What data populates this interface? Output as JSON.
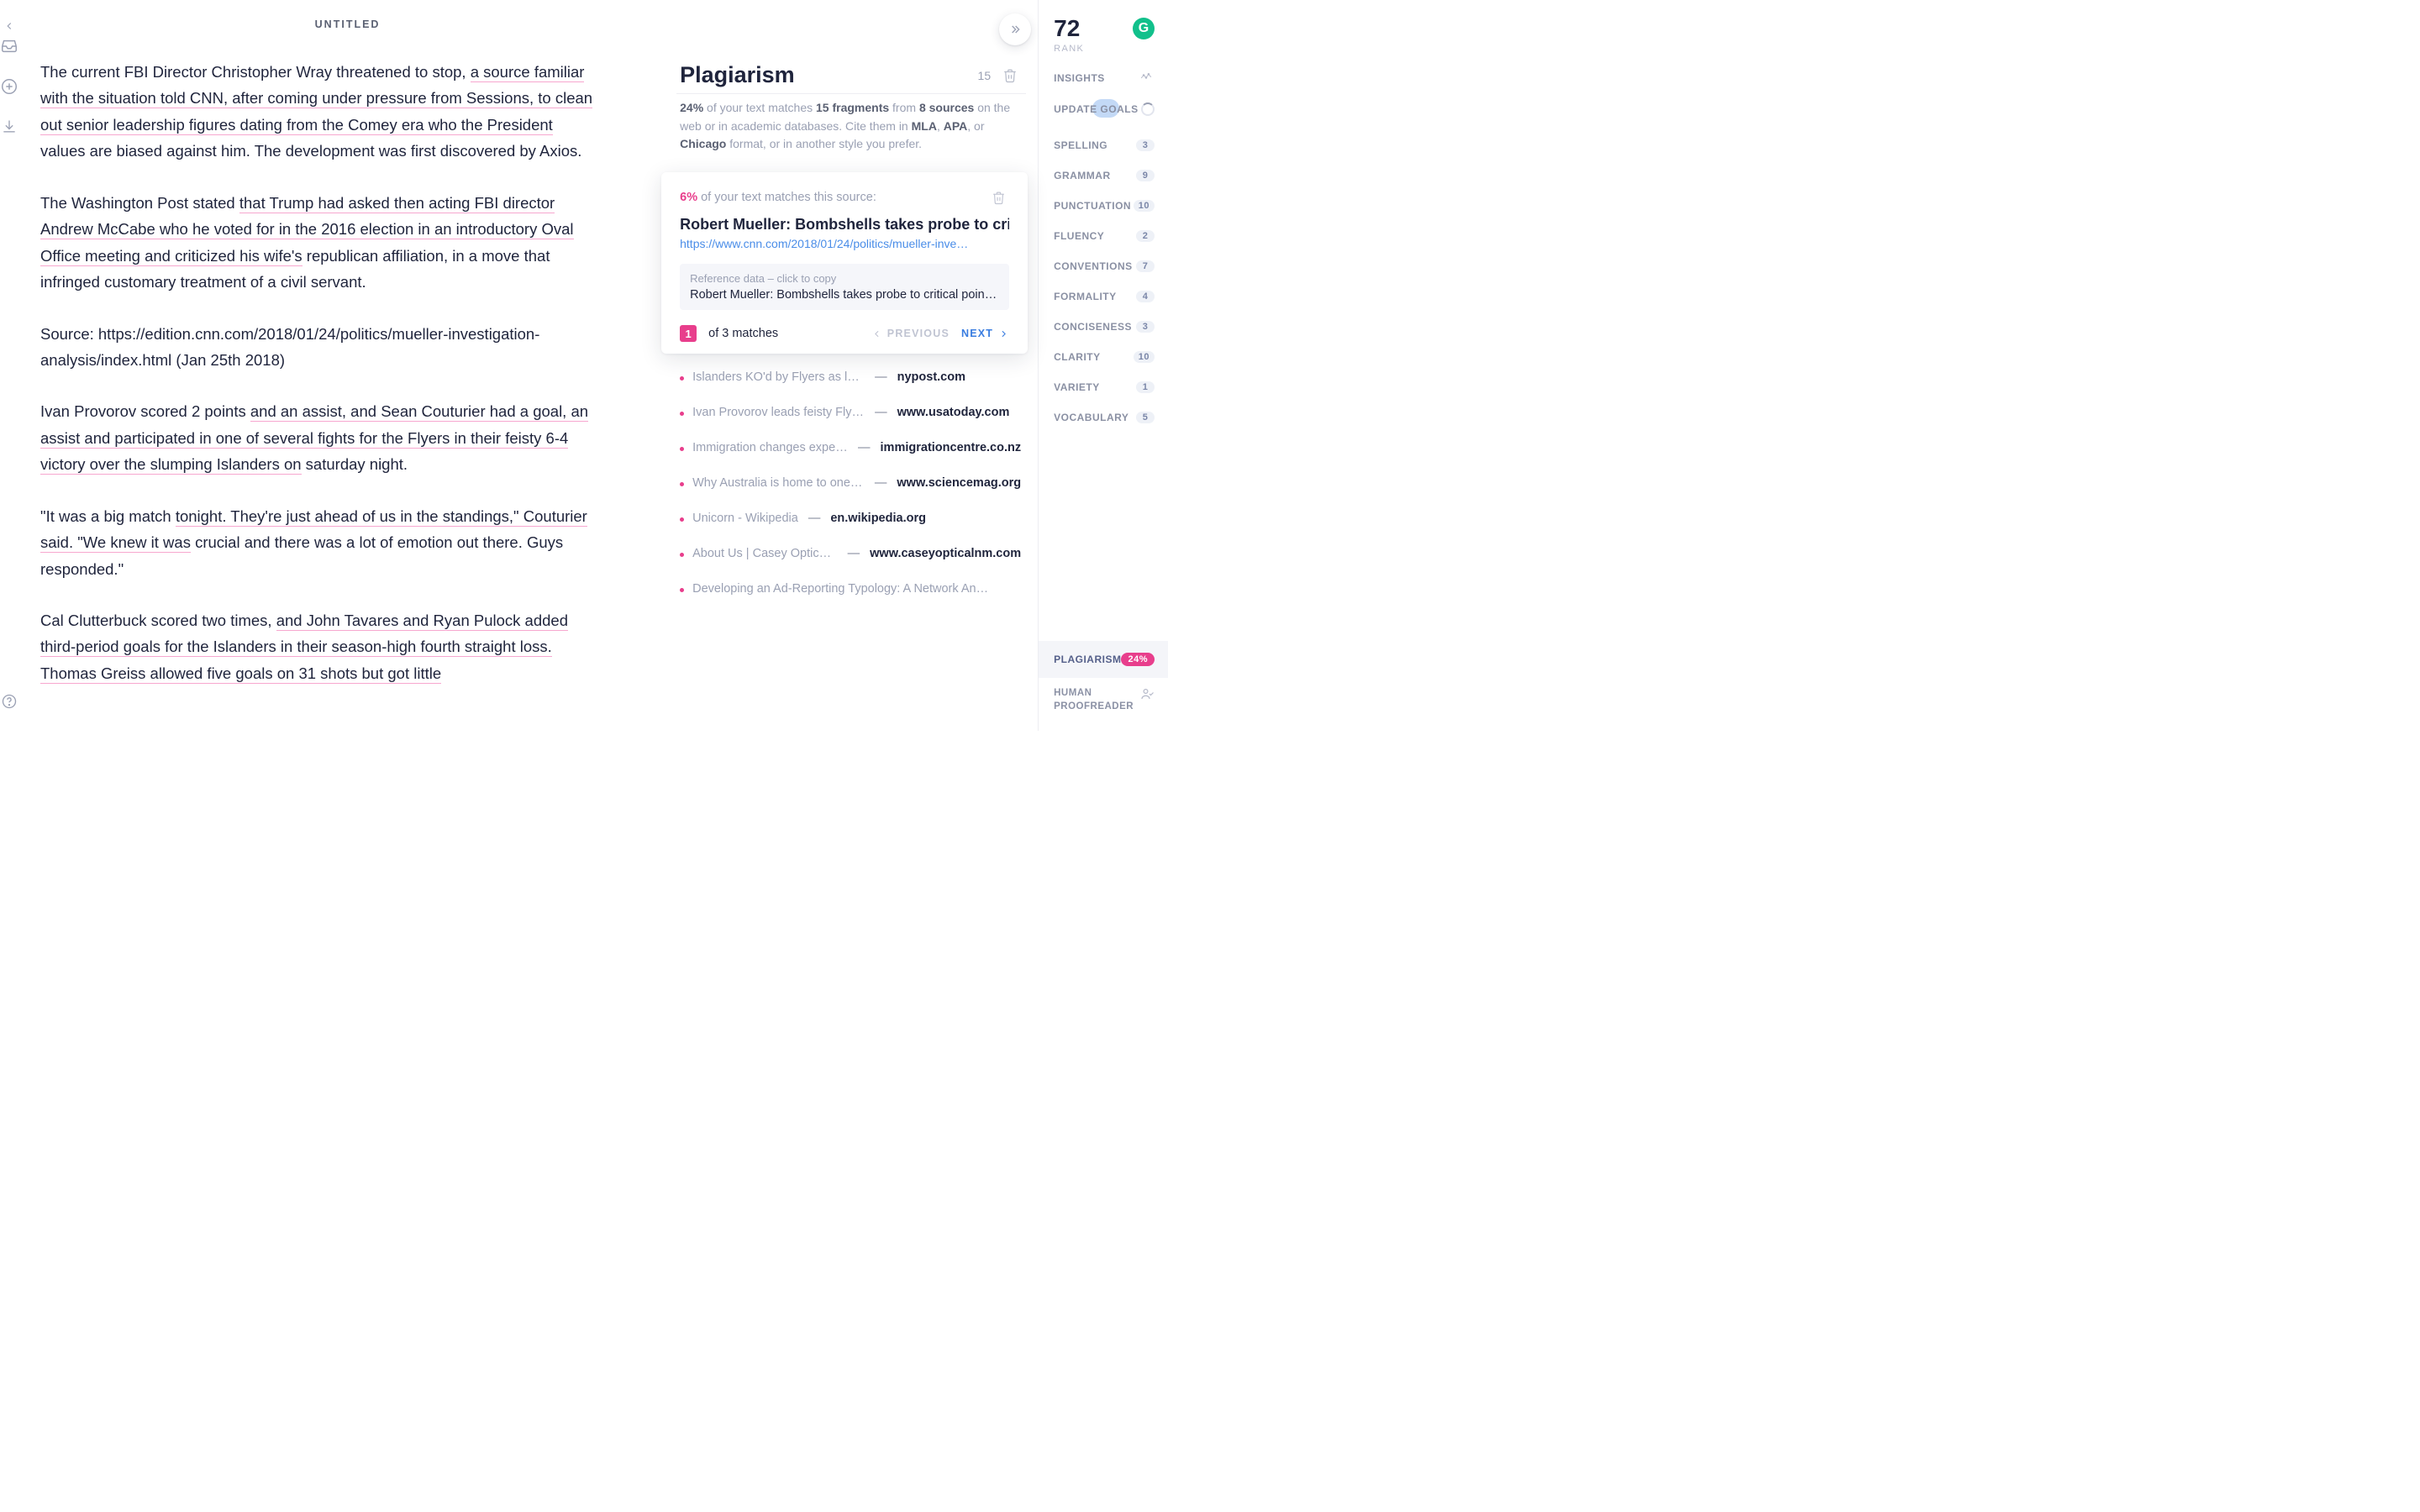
{
  "header": {
    "title": "UNTITLED"
  },
  "editor": {
    "paragraphs": [
      {
        "pre": "The current FBI Director Christopher Wray threatened to stop, ",
        "hl": "a source familiar with the situation told CNN, after coming under pressure from Sessions, to clean out senior leadership figures dating from the Comey era who the President",
        "post": " values are biased against him. The development was first discovered by Axios."
      },
      {
        "pre": "The Washington Post stated ",
        "hl": "that Trump had asked then acting FBI director Andrew McCabe who he voted for in the 2016 election in an introductory Oval Office meeting and criticized his wife's",
        "post": " republican affiliation, in a move that infringed customary treatment of a civil servant."
      },
      {
        "plain": "Source: https://edition.cnn.com/2018/01/24/politics/mueller-investigation-analysis/index.html (Jan 25th 2018)"
      },
      {
        "pre": "Ivan Provorov scored 2 points ",
        "hl": "and an assist, and Sean Couturier had a goal, an assist and participated in one of several fights for the Flyers in their feisty 6-4 victory over the slumping Islanders on",
        "post": " saturday night."
      },
      {
        "pre": "\"It was a big match ",
        "hl": "tonight. They're just ahead of us in the standings,\" Couturier said. \"We knew it was",
        "post": " crucial and there was a lot of emotion out there. Guys responded.\""
      },
      {
        "pre": "Cal Clutterbuck scored two times, ",
        "hl": "and John Tavares and Ryan Pulock added third-period goals for the Islanders in their season-high fourth straight loss. Thomas Greiss allowed five goals on 31 shots but got little",
        "post": ""
      }
    ]
  },
  "panel": {
    "title": "Plagiarism",
    "total_count": "15",
    "summary": {
      "pct": "24%",
      "frag": "15 fragments",
      "sources": "8 sources",
      "fmt1": "MLA",
      "fmt2": "APA",
      "fmt3": "Chicago",
      "txt1": " of your text matches ",
      "txt2": " from ",
      "txt3": " on the web or in academic databases. Cite them in ",
      "txt4": ", or ",
      "txt5": " format, or in another style you prefer."
    },
    "card": {
      "pct": "6%",
      "pct_rest": " of your text matches this source:",
      "headline": "Robert Mueller: Bombshells takes probe to critical point",
      "url": "https://www.cnn.com/2018/01/24/politics/mueller-inve…",
      "ref_label": "Reference data – click to copy",
      "ref_value": "Robert Mueller: Bombshells takes probe to critical point .… ht…",
      "match_index": "1",
      "match_total": "of 3 matches",
      "prev": "PREVIOUS",
      "next": "NEXT"
    },
    "sources": [
      {
        "title": "Islanders KO'd by Flyers as losing streak st…",
        "domain": "nypost.com"
      },
      {
        "title": "Ivan Provorov leads feisty Flyers to …",
        "domain": "www.usatoday.com"
      },
      {
        "title": "Immigration changes expecte…",
        "domain": "immigrationcentre.co.nz"
      },
      {
        "title": "Why Australia is home to one of t…",
        "domain": "www.sciencemag.org"
      },
      {
        "title": "Unicorn - Wikipedia",
        "domain": "en.wikipedia.org"
      },
      {
        "title": "About Us | Casey Optical | Al…",
        "domain": "www.caseyopticalnm.com"
      },
      {
        "title": "Developing an Ad-Reporting Typology: A Network Analysis …",
        "domain": ""
      }
    ]
  },
  "right": {
    "score": "72",
    "rank_label": "RANK",
    "insights": "INSIGHTS",
    "goals": "UPDATE GOALS",
    "categories": [
      {
        "name": "SPELLING",
        "n": "3"
      },
      {
        "name": "GRAMMAR",
        "n": "9"
      },
      {
        "name": "PUNCTUATION",
        "n": "10"
      },
      {
        "name": "FLUENCY",
        "n": "2"
      },
      {
        "name": "CONVENTIONS",
        "n": "7"
      },
      {
        "name": "FORMALITY",
        "n": "4"
      },
      {
        "name": "CONCISENESS",
        "n": "3"
      },
      {
        "name": "CLARITY",
        "n": "10"
      },
      {
        "name": "VARIETY",
        "n": "1"
      },
      {
        "name": "VOCABULARY",
        "n": "5"
      }
    ],
    "plagiarism_label": "PLAGIARISM",
    "plagiarism_pct": "24%",
    "human_label": "HUMAN PROOFREADER"
  }
}
